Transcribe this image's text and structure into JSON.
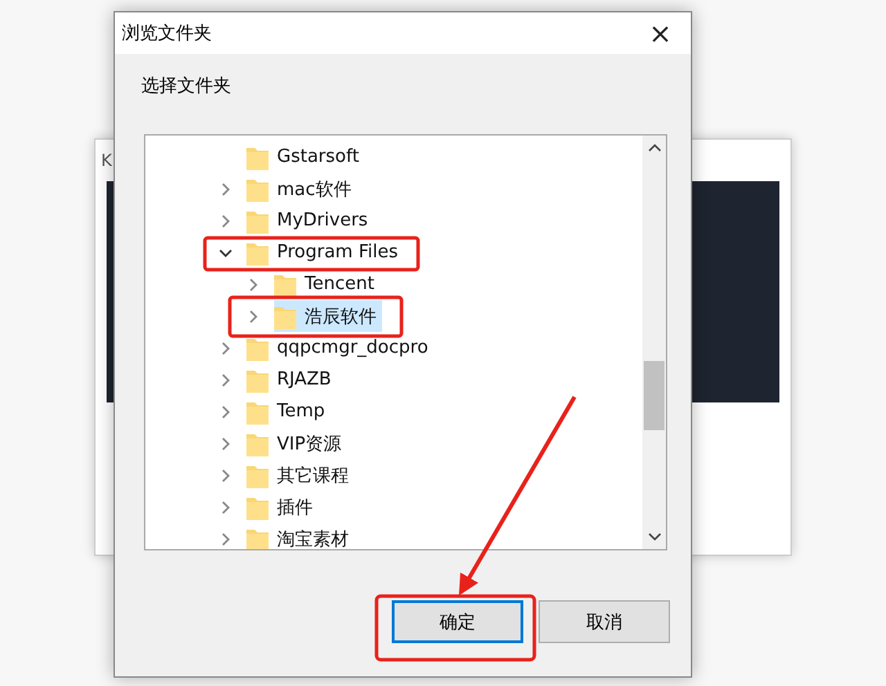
{
  "background_window": {
    "title": "K"
  },
  "dialog": {
    "title": "浏览文件夹",
    "close": "×",
    "prompt": "选择文件夹"
  },
  "tree": [
    {
      "label": "Gstarsoft",
      "has_children": false,
      "expanded": false,
      "selected": false
    },
    {
      "label": "mac软件",
      "has_children": true,
      "expanded": false,
      "selected": false
    },
    {
      "label": "MyDrivers",
      "has_children": true,
      "expanded": false,
      "selected": false
    },
    {
      "label": "Program Files",
      "has_children": true,
      "expanded": true,
      "selected": false,
      "children": [
        {
          "label": "Tencent",
          "has_children": true,
          "expanded": false,
          "selected": false
        },
        {
          "label": "浩辰软件",
          "has_children": true,
          "expanded": false,
          "selected": true
        }
      ]
    },
    {
      "label": "qqpcmgr_docpro",
      "has_children": true,
      "expanded": false,
      "selected": false
    },
    {
      "label": "RJAZB",
      "has_children": true,
      "expanded": false,
      "selected": false
    },
    {
      "label": "Temp",
      "has_children": true,
      "expanded": false,
      "selected": false
    },
    {
      "label": "VIP资源",
      "has_children": true,
      "expanded": false,
      "selected": false
    },
    {
      "label": "其它课程",
      "has_children": true,
      "expanded": false,
      "selected": false
    },
    {
      "label": "插件",
      "has_children": true,
      "expanded": false,
      "selected": false
    },
    {
      "label": "淘宝素材",
      "has_children": true,
      "expanded": false,
      "selected": false
    }
  ],
  "buttons": [
    {
      "label": "确定",
      "default": true
    },
    {
      "label": "取消",
      "default": false
    }
  ]
}
